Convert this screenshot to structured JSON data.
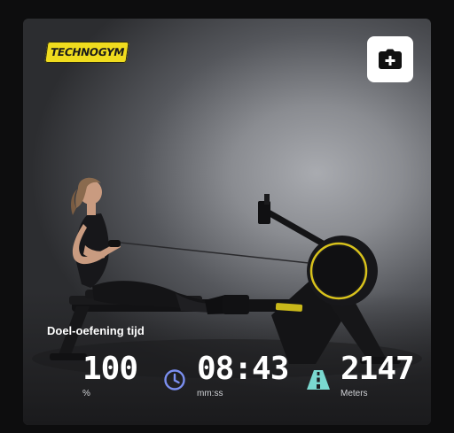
{
  "brand": {
    "logo_text": "TECHNOGYM"
  },
  "actions": {
    "camera_icon": "camera-plus-icon"
  },
  "workout": {
    "goal_label": "Doel-oefening tijd",
    "stats": [
      {
        "value": "100",
        "unit": "%",
        "icon": ""
      },
      {
        "value": "08:43",
        "unit": "mm:ss",
        "icon": "clock-icon"
      },
      {
        "value": "2147",
        "unit": "Meters",
        "icon": "road-icon"
      }
    ]
  },
  "colors": {
    "accent_yellow": "#f0dc1e",
    "clock_blue": "#7b8ff0",
    "road_teal": "#7ad8cf"
  }
}
